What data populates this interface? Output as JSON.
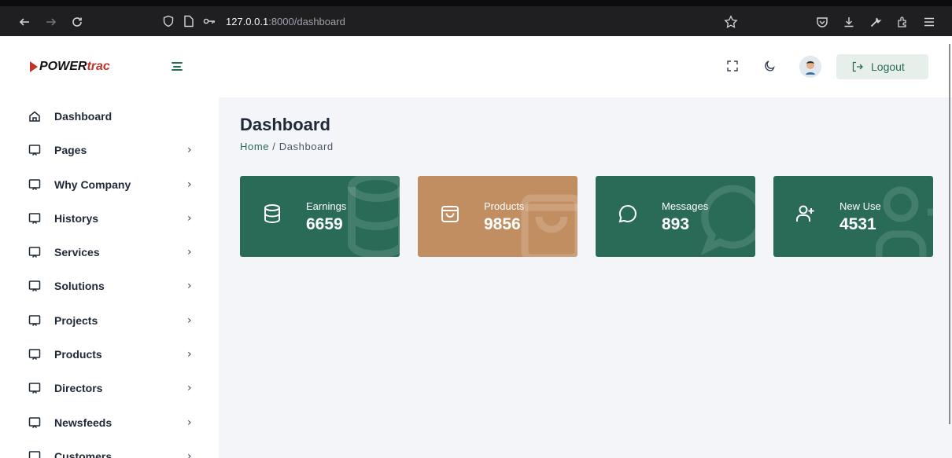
{
  "browser": {
    "url_host": "127.0.0.1",
    "url_path": ":8000/dashboard"
  },
  "brand": {
    "logo_main": "POWER",
    "logo_accent": "trac",
    "accent_color": "#c0342b"
  },
  "sidebar": {
    "items": [
      {
        "label": "Dashboard",
        "icon": "home-icon",
        "has_chevron": false
      },
      {
        "label": "Pages",
        "icon": "monitor-icon",
        "has_chevron": true
      },
      {
        "label": "Why Company",
        "icon": "monitor-icon",
        "has_chevron": true
      },
      {
        "label": "Historys",
        "icon": "monitor-icon",
        "has_chevron": true
      },
      {
        "label": "Services",
        "icon": "monitor-icon",
        "has_chevron": true
      },
      {
        "label": "Solutions",
        "icon": "monitor-icon",
        "has_chevron": true
      },
      {
        "label": "Projects",
        "icon": "monitor-icon",
        "has_chevron": true
      },
      {
        "label": "Products",
        "icon": "monitor-icon",
        "has_chevron": true
      },
      {
        "label": "Directors",
        "icon": "monitor-icon",
        "has_chevron": true
      },
      {
        "label": "Newsfeeds",
        "icon": "monitor-icon",
        "has_chevron": true
      },
      {
        "label": "Customers",
        "icon": "monitor-icon",
        "has_chevron": true
      }
    ],
    "chevron": "›"
  },
  "header": {
    "logout_label": "Logout"
  },
  "main": {
    "title": "Dashboard",
    "breadcrumb_home": "Home",
    "breadcrumb_sep": "/",
    "breadcrumb_current": "Dashboard"
  },
  "cards": [
    {
      "label": "Earnings",
      "value": "6659",
      "icon": "database-icon",
      "color": "#2a6b58"
    },
    {
      "label": "Products",
      "value": "9856",
      "icon": "shopping-bag-icon",
      "color": "#c18e61"
    },
    {
      "label": "Messages",
      "value": "893",
      "icon": "message-circle-icon",
      "color": "#2a6b58"
    },
    {
      "label": "New Use",
      "value": "4531",
      "icon": "user-plus-icon",
      "color": "#2a6b58"
    }
  ],
  "colors": {
    "primary": "#2a6b58",
    "secondary": "#c18e61",
    "content_bg": "#f3f5f9"
  }
}
